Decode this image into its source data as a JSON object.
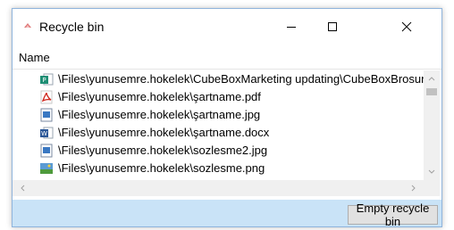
{
  "window": {
    "title": "Recycle bin",
    "controls": {
      "minimize_icon": "minimize-icon",
      "maximize_icon": "maximize-icon",
      "close_icon": "close-icon"
    }
  },
  "list": {
    "column_header": "Name",
    "items": [
      {
        "path": "\\Files\\yunusemre.hokelek\\CubeBoxMarketing updating\\CubeBoxBrosur-Su",
        "icon": "publisher-file-icon"
      },
      {
        "path": "\\Files\\yunusemre.hokelek\\şartname.pdf",
        "icon": "pdf-file-icon"
      },
      {
        "path": "\\Files\\yunusemre.hokelek\\şartname.jpg",
        "icon": "image-file-icon"
      },
      {
        "path": "\\Files\\yunusemre.hokelek\\şartname.docx",
        "icon": "word-file-icon"
      },
      {
        "path": "\\Files\\yunusemre.hokelek\\sozlesme2.jpg",
        "icon": "image-file-icon"
      },
      {
        "path": "\\Files\\yunusemre.hokelek\\sozlesme.png",
        "icon": "png-file-icon"
      }
    ]
  },
  "footer": {
    "empty_button": "Empty recycle bin"
  },
  "colors": {
    "footer_bg": "#c9e3f7",
    "window_border": "#8fb4dc"
  }
}
